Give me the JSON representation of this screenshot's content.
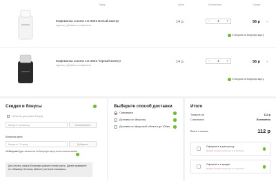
{
  "headers": {
    "product": "Товар",
    "price": "Цена",
    "quantity": "Количество",
    "sum": "Сумма"
  },
  "items": [
    {
      "name": "Кофемолка Lumme LU-2601 Белый жемчуг",
      "actions": "Удалить | Добавить в избранное",
      "price": "14 р.",
      "qty": "4",
      "sum": "56 р",
      "bonus": "6 бонусов на бонусную карту"
    },
    {
      "name": "Кофемолка Lumme LU-2601 Черный жемчуг",
      "actions": "Удалить | Добавить в избранное",
      "price": "14 р.",
      "qty": "4",
      "sum": "56 р",
      "bonus": "6 бонусов на бонусную карту"
    }
  ],
  "qty_minus": "−",
  "qty_plus": "+",
  "close_symbol": "×",
  "discounts": {
    "title": "Скидки и бонусы",
    "use_bonuses": "Оплатить доступные бонусы",
    "promo_placeholder": "Введите промокод",
    "promo_button": "Активировать",
    "card_label": "Бонусная карта",
    "card_placeholder": "Введите 15 цифр",
    "card_button": "Добавить",
    "bonus_info_bold": "12 бонусов",
    "bonus_info_rest": "будет начислено на бонусную карту после оплаты заказа",
    "note": "Для оплаты заказа бонусами укажите номер карты. Далее привяжите ее к Вашему Личному кабинету интернет-магазина."
  },
  "delivery": {
    "title": "Выберите способ доставки",
    "options": [
      {
        "label": "Самовывоз",
        "selected": true
      },
      {
        "label": "Доставка по Иркутску",
        "selected": false
      },
      {
        "label": "Доставка по Иркутской области до 100км",
        "selected": false
      }
    ]
  },
  "summary": {
    "title": "Итого",
    "goods_label": "Товаров на",
    "goods_value": "112 р",
    "pickup_label": "Самовывоз",
    "pickup_value": "Бесплатно",
    "total_label": "Всего к оплате",
    "total_value": "112 р",
    "installment_title": "Оформить в рассрочку",
    "installment_sub_red": "Низкий платеж",
    "installment_sub": "рассрочка от 6 месяцев",
    "credit_title": "Оформить в кредит",
    "credit_sub_red": "Низкий платеж",
    "credit_sub": "рассрочка от 6 месяцев"
  },
  "colors": {
    "accent_green": "#6fbe2e",
    "radio_red": "#e73c3c"
  }
}
